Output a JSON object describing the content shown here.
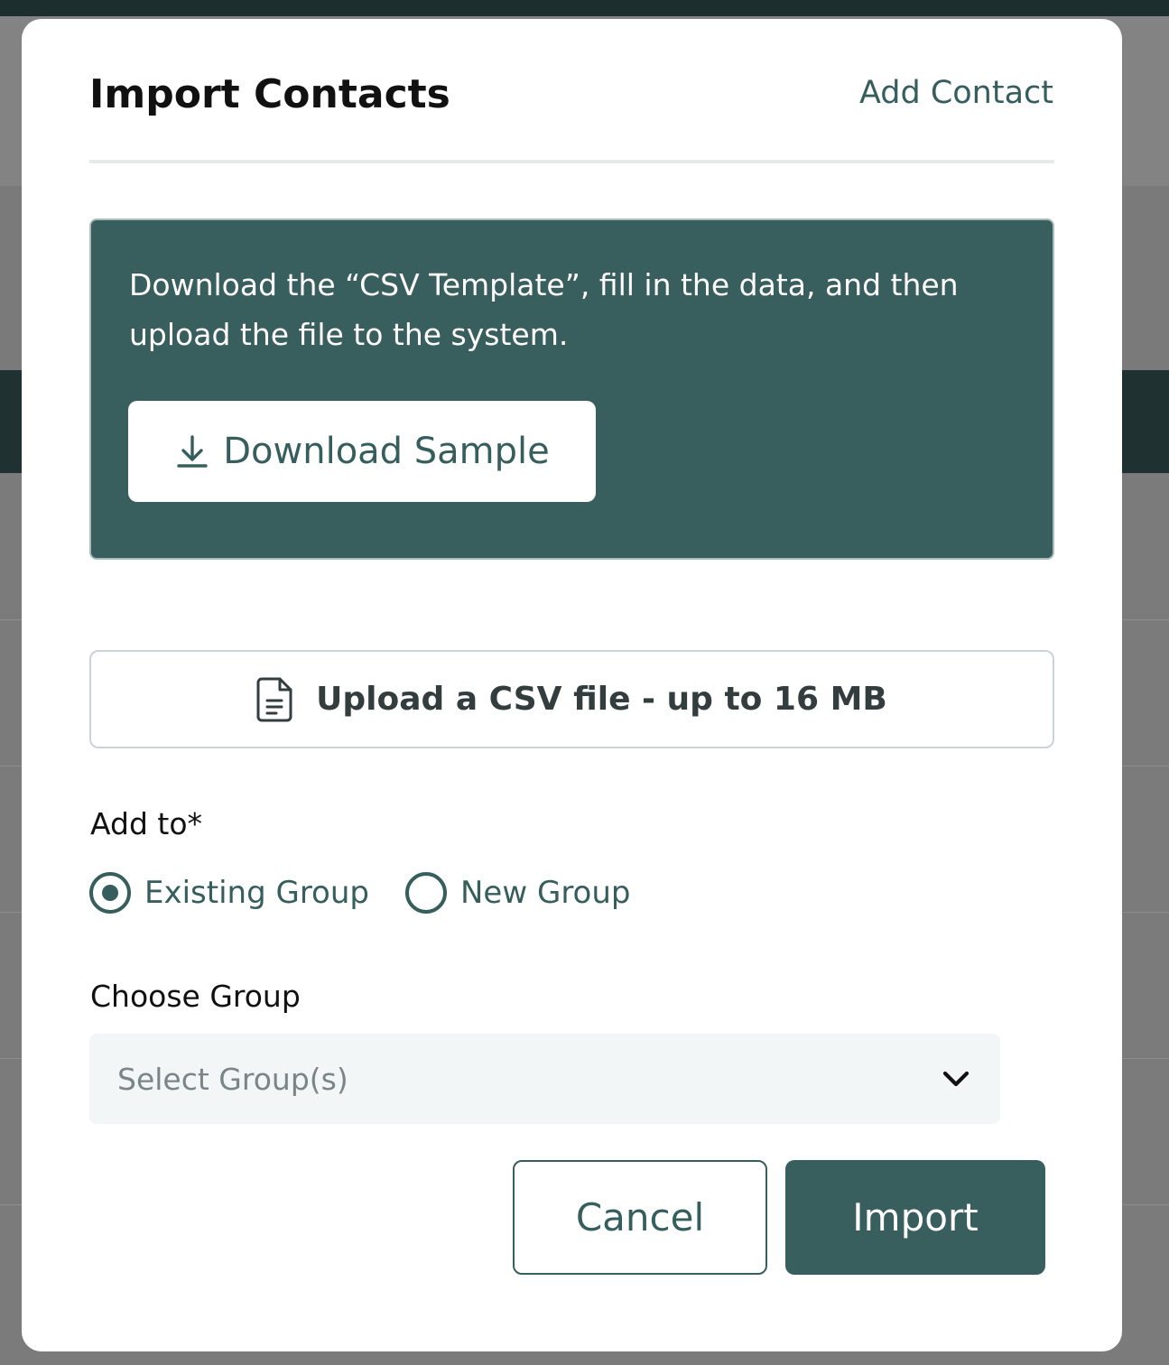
{
  "modal": {
    "title": "Import Contacts",
    "add_contact_link": "Add Contact"
  },
  "info_panel": {
    "text": "Download the “CSV Template”, fill in the data, and then upload the file to the system.",
    "download_button": "Download Sample",
    "download_icon": "download-icon"
  },
  "upload": {
    "label": "Upload a CSV file - up to 16 MB",
    "icon": "document-icon"
  },
  "add_to": {
    "label": "Add to*",
    "options": [
      {
        "label": "Existing Group",
        "selected": true
      },
      {
        "label": "New Group",
        "selected": false
      }
    ]
  },
  "choose_group": {
    "label": "Choose Group",
    "placeholder": "Select Group(s)",
    "icon": "chevron-down-icon"
  },
  "actions": {
    "cancel": "Cancel",
    "import": "Import"
  },
  "colors": {
    "accent": "#365e5c",
    "panel": "#385e5d",
    "backdrop": "#7b7b7b"
  }
}
